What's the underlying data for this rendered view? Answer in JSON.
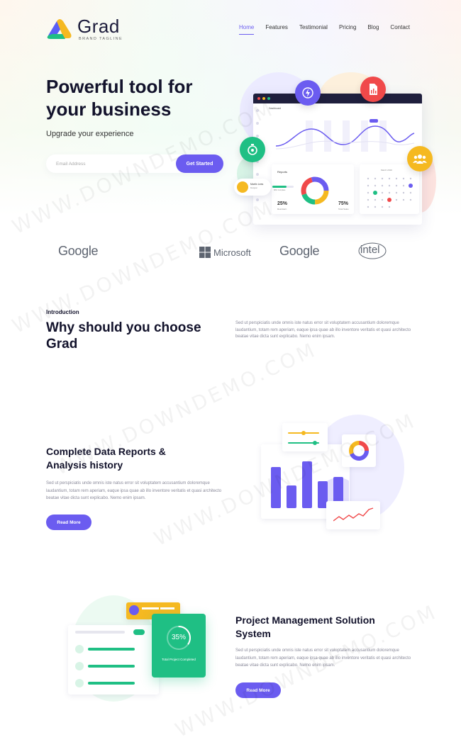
{
  "brand": {
    "name": "Grad",
    "tagline": "BRAND TAGLINE",
    "colors": {
      "primary": "#6b5cf0",
      "green": "#1fbf84",
      "yellow": "#f5b921",
      "red": "#f0494a",
      "dark": "#12122b"
    }
  },
  "nav": {
    "items": [
      {
        "label": "Home",
        "active": true
      },
      {
        "label": "Features"
      },
      {
        "label": "Testimonial"
      },
      {
        "label": "Pricing"
      },
      {
        "label": "Blog"
      },
      {
        "label": "Contact"
      }
    ]
  },
  "hero": {
    "title": "Powerful tool for your business",
    "subtitle": "Upgrade your experience",
    "email_placeholder": "Email Address",
    "cta_label": "Get Started"
  },
  "dashboard": {
    "title": "Dashboard",
    "reports_label": "Reports",
    "calendar_label": "March 2019",
    "profile_name": "Martin Lees",
    "profile_role": "Designer",
    "progress_label": "68% Complete",
    "stat_left": "25%",
    "stat_left_label": "Real Earn",
    "stat_right": "75%",
    "stat_right_label": "Total Sales",
    "chart_badge": "$340",
    "icons": [
      "lightning-icon",
      "document-icon",
      "timer-icon",
      "team-icon"
    ]
  },
  "brands": [
    "Google",
    "Microsoft",
    "Google",
    "intel"
  ],
  "intro": {
    "eyebrow": "Introduction",
    "title": "Why should you choose Grad",
    "text": "Sed ut perspiciatis unde omnis iste natus error sit voluptatem accusantium doloremque laudantium, totam rem aperiam, eaque ipsa quae ab illo inventore veritatis et quasi architecto beatae vitae dicta sunt explicabo. Nemo enim ipsam."
  },
  "feature1": {
    "title": "Complete Data Reports & Analysis history",
    "text": "Sed ut perspiciatis unde omnis iste natus error sit voluptatem accusantium doloremque laudantium, totam rem aperiam, eaque ipsa quae ab illo inventore veritatis et quasi architecto beatae vitae dicta sunt explicabo. Nemo enim ipsam.",
    "button": "Read More"
  },
  "feature2": {
    "title": "Project Management Solution System",
    "text": "Sed ut perspiciatis unde omnis iste natus error sit voluptatem accusantium doloremque laudantium, totam rem aperiam, eaque ipsa quae ab illo inventore veritatis et quasi architecto beatae vitae dicta sunt explicabo. Nemo enim ipsam.",
    "button": "Read More",
    "card_value": "35%",
    "card_label": "Total Project Completed"
  },
  "watermark": "WWW.DOWNDEMO.COM"
}
